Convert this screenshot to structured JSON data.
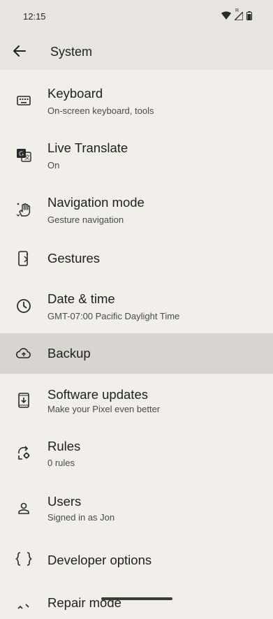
{
  "status_bar": {
    "time": "12:15",
    "signal_badge": "R"
  },
  "app_bar": {
    "title": "System"
  },
  "items": [
    {
      "title": "Keyboard",
      "subtitle": "On-screen keyboard, tools",
      "icon": "keyboard-icon"
    },
    {
      "title": "Live Translate",
      "subtitle": "On",
      "icon": "live-translate-icon"
    },
    {
      "title": "Navigation mode",
      "subtitle": "Gesture navigation",
      "icon": "gesture-hand-icon"
    },
    {
      "title": "Gestures",
      "subtitle": "",
      "icon": "phone-gesture-icon"
    },
    {
      "title": "Date & time",
      "subtitle": "GMT-07:00 Pacific Daylight Time",
      "icon": "clock-icon"
    },
    {
      "title": "Backup",
      "subtitle": "",
      "icon": "cloud-upload-icon"
    },
    {
      "title": "Software updates",
      "subtitle": "Make your Pixel even better",
      "icon": "system-update-icon"
    },
    {
      "title": "Rules",
      "subtitle": "0 rules",
      "icon": "rules-icon"
    },
    {
      "title": "Users",
      "subtitle": "Signed in as Jon",
      "icon": "person-icon"
    },
    {
      "title": "Developer options",
      "subtitle": "",
      "icon": "braces-icon"
    },
    {
      "title": "Repair mode",
      "subtitle": "",
      "icon": "repair-icon"
    }
  ],
  "colors": {
    "background": "#f2eeea",
    "app_bar": "#e8e4df",
    "highlight": "#d8d4d0"
  }
}
